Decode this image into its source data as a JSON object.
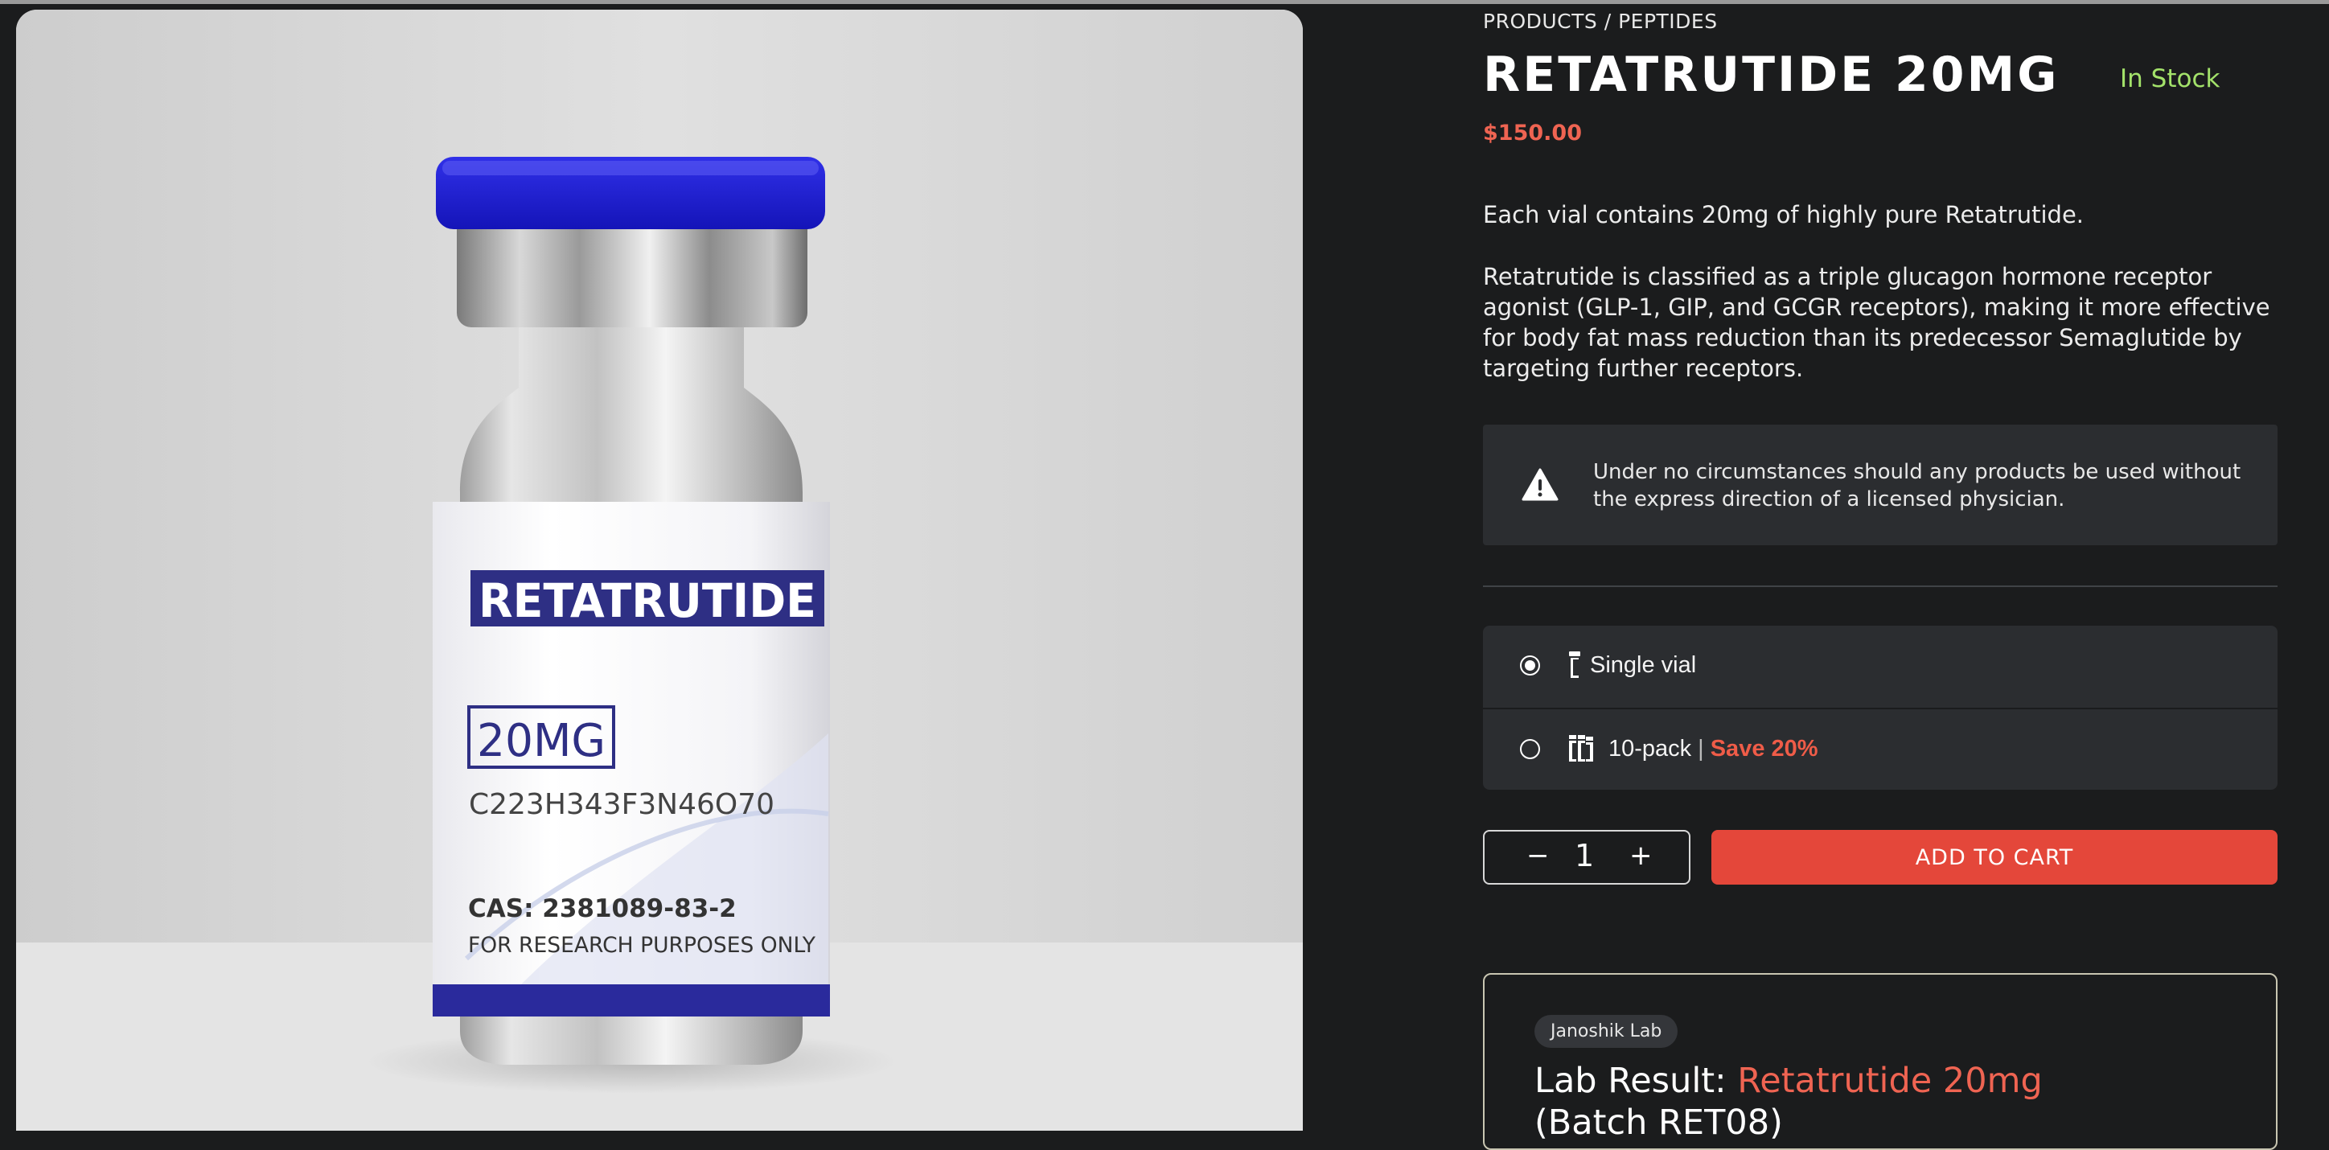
{
  "breadcrumb": "PRODUCTS / PEPTIDES",
  "product": {
    "title": "RETATRUTIDE 20MG",
    "stock_status": "In Stock",
    "price": "$150.00",
    "description_1": "Each vial contains 20mg of highly pure Retatrutide.",
    "description_2": "Retatrutide is classified as a triple glucagon hormone receptor agonist (GLP-1, GIP, and GCGR receptors), making it more effective for body fat mass reduction than its predecessor Semaglutide by targeting further receptors."
  },
  "vial_label": {
    "name": "RETATRUTIDE",
    "dose": "20MG",
    "formula": "C223H343F3N46O70",
    "cas_prefix": "CAS: ",
    "cas_number": "2381089-83-2",
    "disclaimer": "FOR RESEARCH PURPOSES ONLY"
  },
  "warning": {
    "icon": "warning-triangle-icon",
    "text": "Under no circumstances should any products be used without the express direction of a licensed physician."
  },
  "options": [
    {
      "label": "Single vial",
      "selected": true,
      "icon": "single-vial-icon"
    },
    {
      "label": "10-pack",
      "separator": "|",
      "savings": "Save 20%",
      "selected": false,
      "icon": "multi-vial-icon"
    }
  ],
  "quantity": {
    "minus": "−",
    "value": "1",
    "plus": "+"
  },
  "cart_button": "ADD TO CART",
  "lab_result": {
    "badge": "Janoshik Lab",
    "prefix": "Lab Result: ",
    "product": "Retatrutide 20mg",
    "batch": "(Batch RET08)"
  },
  "colors": {
    "background": "#1b1c1d",
    "accent_red": "#e4473a",
    "price_red": "#ef6452",
    "stock_green": "#a3e26a",
    "cap_blue": "#1a1ad0",
    "label_navy": "#2e2f84"
  }
}
